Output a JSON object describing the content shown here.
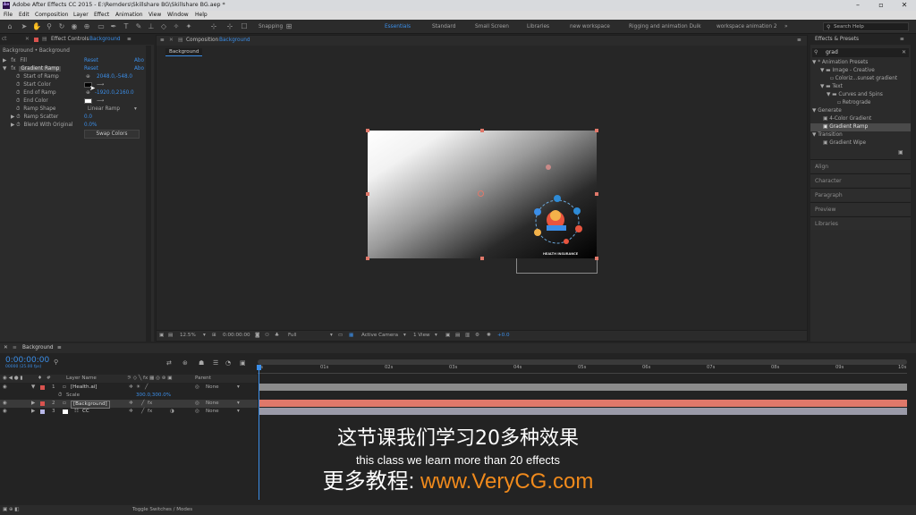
{
  "title_bar": {
    "logo": "Ae",
    "title": "Adobe After Effects CC 2015 - E:\\Remders\\Skillshare BG\\Skillshare BG.aep *"
  },
  "menu": [
    "File",
    "Edit",
    "Composition",
    "Layer",
    "Effect",
    "Animation",
    "View",
    "Window",
    "Help"
  ],
  "toolbar": {
    "snapping": "Snapping",
    "workspaces": [
      "Essentials",
      "Standard",
      "Small Screen",
      "Libraries",
      "new workspace",
      "Rigging and animation Duik",
      "workspace animation 2"
    ],
    "search_placeholder": "Search Help"
  },
  "effect_controls": {
    "tab_prefix": "Effect Controls",
    "tab_layer": "Background",
    "breadcrumb": "Background • Background",
    "fill": {
      "label": "Fill",
      "reset": "Reset",
      "about": "Abo"
    },
    "gradient_ramp": {
      "label": "Gradient Ramp",
      "reset": "Reset",
      "about": "Abo"
    },
    "props": [
      {
        "label": "Start of Ramp",
        "value": "2048.0,-548.0"
      },
      {
        "label": "Start Color",
        "value": ""
      },
      {
        "label": "End of Ramp",
        "value": "-1920.0,2160.0"
      },
      {
        "label": "End Color",
        "value": ""
      },
      {
        "label": "Ramp Shape",
        "value": "Linear Ramp"
      },
      {
        "label": "Ramp Scatter",
        "value": "0.0"
      },
      {
        "label": "Blend With Original",
        "value": "0.0%"
      }
    ],
    "swap_colors": "Swap Colors"
  },
  "composition": {
    "tab_prefix": "Composition",
    "tab_name": "Background",
    "subtab": "Background",
    "artwork_caption": "HEALTH INSURANCE",
    "footer": {
      "zoom": "12.5%",
      "time": "0:00:00:00",
      "resolution": "Full",
      "camera": "Active Camera",
      "views": "1 View",
      "exposure": "+0.0"
    }
  },
  "effects_presets": {
    "title": "Effects & Presets",
    "search_value": "grad",
    "tree": [
      {
        "label": "* Animation Presets",
        "indent": 0
      },
      {
        "label": "Image - Creative",
        "indent": 1
      },
      {
        "label": "Coloriz...sunset gradient",
        "indent": 2
      },
      {
        "label": "Text",
        "indent": 1
      },
      {
        "label": "Curves and Spins",
        "indent": 2
      },
      {
        "label": "Retrograde",
        "indent": 3
      },
      {
        "label": "Generate",
        "indent": 0
      },
      {
        "label": "4-Color Gradient",
        "indent": 1
      },
      {
        "label": "Gradient Ramp",
        "indent": 1,
        "selected": true
      },
      {
        "label": "Transition",
        "indent": 0
      },
      {
        "label": "Gradient Wipe",
        "indent": 1
      }
    ],
    "sections": [
      "Align",
      "Character",
      "Paragraph",
      "Preview",
      "Libraries"
    ]
  },
  "timeline": {
    "tab": "Background",
    "timecode": "0:00:00:00",
    "fps": "00000 (25.00 fps)",
    "col_layer_name": "Layer Name",
    "col_parent": "Parent",
    "layers": [
      {
        "num": "1",
        "name": "[Health.ai]",
        "parent": "None",
        "color": "#d9534f"
      },
      {
        "num": "2",
        "name": "[Background]",
        "parent": "None",
        "color": "#d9534f"
      },
      {
        "num": "3",
        "name": "CC",
        "parent": "None",
        "color": "#b8b8e8"
      }
    ],
    "scale_label": "Scale",
    "scale_value": "300.0,300.0%",
    "ticks": [
      "0s",
      "01s",
      "02s",
      "03s",
      "04s",
      "05s",
      "06s",
      "07s",
      "08s",
      "09s",
      "10s"
    ],
    "toggle_label": "Toggle Switches / Modes"
  },
  "subtitles": {
    "line1": "这节课我们学习20多种效果",
    "line2": "this class we learn more than 20 effects",
    "line3_prefix": "更多教程: ",
    "line3_link": "www.VeryCG.com"
  },
  "colors": {
    "accent": "#3b8ee8",
    "link_orange": "#f08a1c",
    "layer_bar": "#e0786a"
  }
}
